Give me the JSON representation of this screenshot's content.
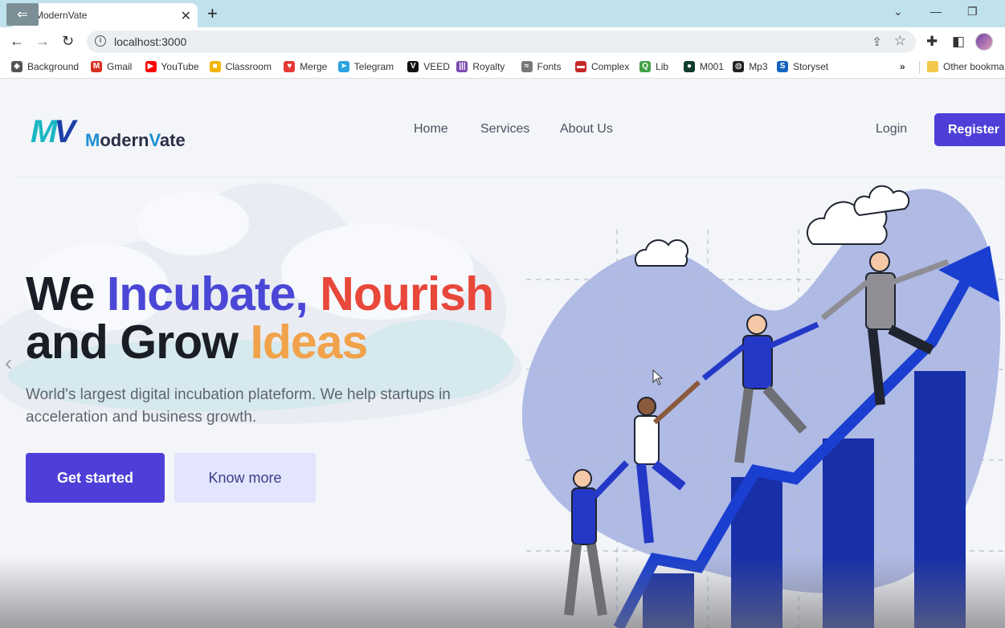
{
  "browser": {
    "tab": {
      "title": "ModernVate",
      "close": "✕",
      "favicon": "MV"
    },
    "new_tab": "+",
    "window": {
      "minimize": "—",
      "restore": "❐",
      "dropdown": "⌄"
    },
    "url": "localhost:3000",
    "bookmarks": [
      {
        "label": "Background",
        "icon": "layers-icon",
        "color": "#555555"
      },
      {
        "label": "Gmail",
        "icon": "gmail-icon",
        "color": "#d93025"
      },
      {
        "label": "YouTube",
        "icon": "youtube-icon",
        "color": "#ff0000"
      },
      {
        "label": "Classroom",
        "icon": "classroom-icon",
        "color": "#f4b400"
      },
      {
        "label": "Merge",
        "icon": "heart-icon",
        "color": "#e53935"
      },
      {
        "label": "Telegram",
        "icon": "telegram-icon",
        "color": "#2aa3df"
      },
      {
        "label": "VEED",
        "icon": "veed-icon",
        "color": "#111111"
      },
      {
        "label": "Royalty",
        "icon": "royalty-icon",
        "color": "#7b4bb0"
      },
      {
        "label": "Fonts",
        "icon": "fonts-icon",
        "color": "#777777"
      },
      {
        "label": "Complex",
        "icon": "complex-icon",
        "color": "#c62828"
      },
      {
        "label": "Lib",
        "icon": "lib-icon",
        "color": "#43a047"
      },
      {
        "label": "M001",
        "icon": "mongodb-icon",
        "color": "#0f3d2e"
      },
      {
        "label": "Mp3",
        "icon": "globe-icon",
        "color": "#222222"
      },
      {
        "label": "Storyset",
        "icon": "storyset-icon",
        "color": "#1565c0"
      }
    ],
    "bookmarks_overflow": "»",
    "other_bookmarks": "Other bookma"
  },
  "site": {
    "logo": {
      "mark_m": "M",
      "mark_v": "V",
      "text_pre": "M",
      "text_mid": "odern",
      "text_v": "V",
      "text_post": "ate"
    },
    "nav": [
      "Home",
      "Services",
      "About Us"
    ],
    "login": "Login",
    "register": "Register",
    "hero": {
      "line1_a": "We ",
      "line1_b": "Incubate,",
      "line1_c": " Nourish",
      "line2_a": "and Grow ",
      "line2_b": "Ideas",
      "subtitle": "World's largest digital incubation plateform. We help startups in acceleration and business growth."
    },
    "cta_primary": "Get started",
    "cta_secondary": "Know more",
    "carousel_prev": "‹"
  },
  "colors": {
    "brand": "#4e3fd8",
    "accent_blue": "#4b47d6",
    "accent_red": "#e8473a",
    "accent_orange": "#f1a24a",
    "chart_blue": "#1a35b8"
  }
}
